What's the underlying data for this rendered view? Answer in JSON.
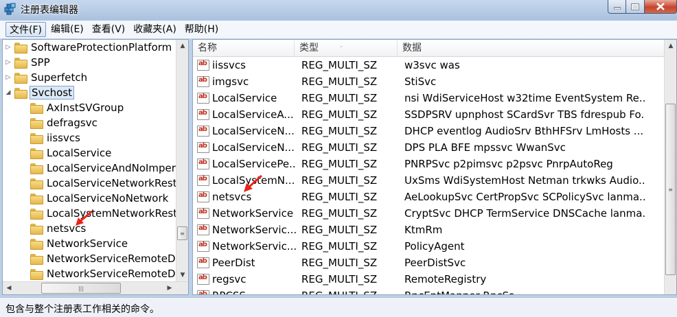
{
  "window": {
    "title": "注册表编辑器"
  },
  "menu": [
    {
      "label": "文件(F)",
      "active": true
    },
    {
      "label": "编辑(E)"
    },
    {
      "label": "查看(V)"
    },
    {
      "label": "收藏夹(A)"
    },
    {
      "label": "帮助(H)"
    }
  ],
  "tree": [
    {
      "label": "SoftwareProtectionPlatform",
      "level": 0,
      "toggle": "▷"
    },
    {
      "label": "SPP",
      "level": 0,
      "toggle": "▷"
    },
    {
      "label": "Superfetch",
      "level": 0,
      "toggle": "▷"
    },
    {
      "label": "Svchost",
      "level": 0,
      "toggle": "◢",
      "selected": true
    },
    {
      "label": "AxInstSVGroup",
      "level": 1
    },
    {
      "label": "defragsvc",
      "level": 1
    },
    {
      "label": "iissvcs",
      "level": 1
    },
    {
      "label": "LocalService",
      "level": 1
    },
    {
      "label": "LocalServiceAndNoImpersonation",
      "level": 1
    },
    {
      "label": "LocalServiceNetworkRestricted",
      "level": 1
    },
    {
      "label": "LocalServiceNoNetwork",
      "level": 1
    },
    {
      "label": "LocalSystemNetworkRestricted",
      "level": 1
    },
    {
      "label": "netsvcs",
      "level": 1
    },
    {
      "label": "NetworkService",
      "level": 1
    },
    {
      "label": "NetworkServiceRemoteDesktop",
      "level": 1
    },
    {
      "label": "NetworkServiceRemoteDesktop",
      "level": 1
    }
  ],
  "columns": {
    "name": "名称",
    "type": "类型",
    "data": "数据"
  },
  "values": [
    {
      "name": "iissvcs",
      "type": "REG_MULTI_SZ",
      "data": "w3svc was"
    },
    {
      "name": "imgsvc",
      "type": "REG_MULTI_SZ",
      "data": "StiSvc"
    },
    {
      "name": "LocalService",
      "type": "REG_MULTI_SZ",
      "data": "nsi WdiServiceHost w32time EventSystem Re..."
    },
    {
      "name": "LocalServiceA...",
      "type": "REG_MULTI_SZ",
      "data": "SSDPSRV upnphost SCardSvr TBS fdrespub Fo..."
    },
    {
      "name": "LocalServiceN...",
      "type": "REG_MULTI_SZ",
      "data": "DHCP eventlog AudioSrv BthHFSrv LmHosts ..."
    },
    {
      "name": "LocalServiceN...",
      "type": "REG_MULTI_SZ",
      "data": "DPS PLA BFE mpssvc WwanSvc"
    },
    {
      "name": "LocalServicePe...",
      "type": "REG_MULTI_SZ",
      "data": "PNRPSvc p2pimsvc p2psvc PnrpAutoReg"
    },
    {
      "name": "LocalSystemN...",
      "type": "REG_MULTI_SZ",
      "data": "UxSms WdiSystemHost Netman trkwks Audio..."
    },
    {
      "name": "netsvcs",
      "type": "REG_MULTI_SZ",
      "data": "AeLookupSvc CertPropSvc SCPolicySvc lanma..."
    },
    {
      "name": "NetworkService",
      "type": "REG_MULTI_SZ",
      "data": "CryptSvc DHCP TermService DNSCache lanma..."
    },
    {
      "name": "NetworkServic...",
      "type": "REG_MULTI_SZ",
      "data": "KtmRm"
    },
    {
      "name": "NetworkServic...",
      "type": "REG_MULTI_SZ",
      "data": "PolicyAgent"
    },
    {
      "name": "PeerDist",
      "type": "REG_MULTI_SZ",
      "data": "PeerDistSvc"
    },
    {
      "name": "regsvc",
      "type": "REG_MULTI_SZ",
      "data": "RemoteRegistry"
    },
    {
      "name": "RPCSS",
      "type": "REG_MULTI_SZ",
      "data": "RpcEptMapper RpcSs"
    }
  ],
  "status": "包含与整个注册表工作相关的命令。",
  "icons": {
    "app": "registry-editor-icon",
    "value": "string-value-ab-icon",
    "folder": "folder-icon",
    "annotation": "red-arrow-icon"
  },
  "colors": {
    "accent_arrow": "#e8231a",
    "selection": "#dce8f6",
    "value_icon": "#c0301e"
  }
}
